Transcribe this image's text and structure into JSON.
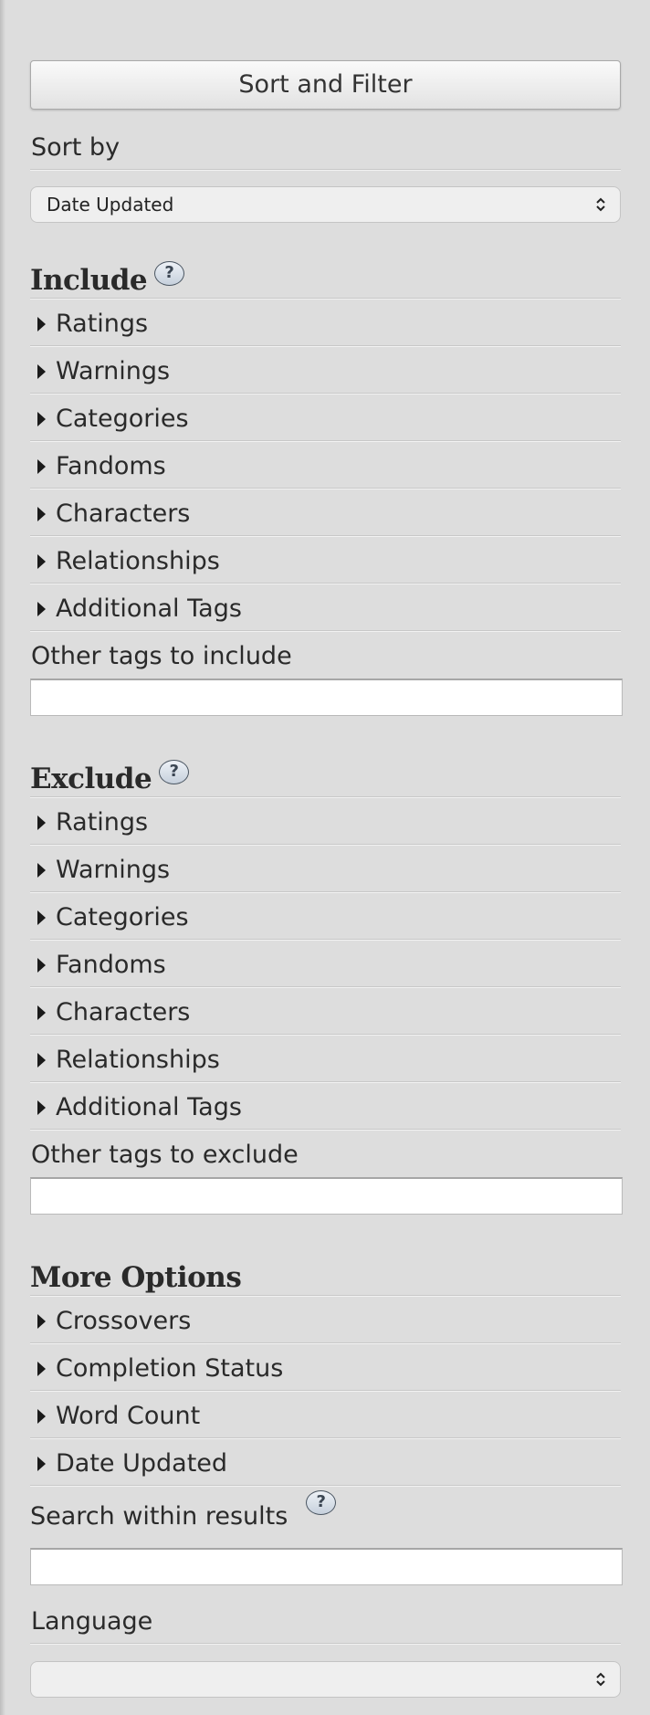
{
  "sort_filter_button": "Sort and Filter",
  "sort_by": {
    "label": "Sort by",
    "selected": "Date Updated"
  },
  "include": {
    "heading": "Include",
    "help": "?",
    "items": [
      "Ratings",
      "Warnings",
      "Categories",
      "Fandoms",
      "Characters",
      "Relationships",
      "Additional Tags"
    ],
    "other_label": "Other tags to include",
    "other_value": ""
  },
  "exclude": {
    "heading": "Exclude",
    "help": "?",
    "items": [
      "Ratings",
      "Warnings",
      "Categories",
      "Fandoms",
      "Characters",
      "Relationships",
      "Additional Tags"
    ],
    "other_label": "Other tags to exclude",
    "other_value": ""
  },
  "more_options": {
    "heading": "More Options",
    "items": [
      "Crossovers",
      "Completion Status",
      "Word Count",
      "Date Updated"
    ],
    "search_label": "Search within results",
    "search_help": "?",
    "search_value": ""
  },
  "language": {
    "label": "Language",
    "selected": ""
  }
}
